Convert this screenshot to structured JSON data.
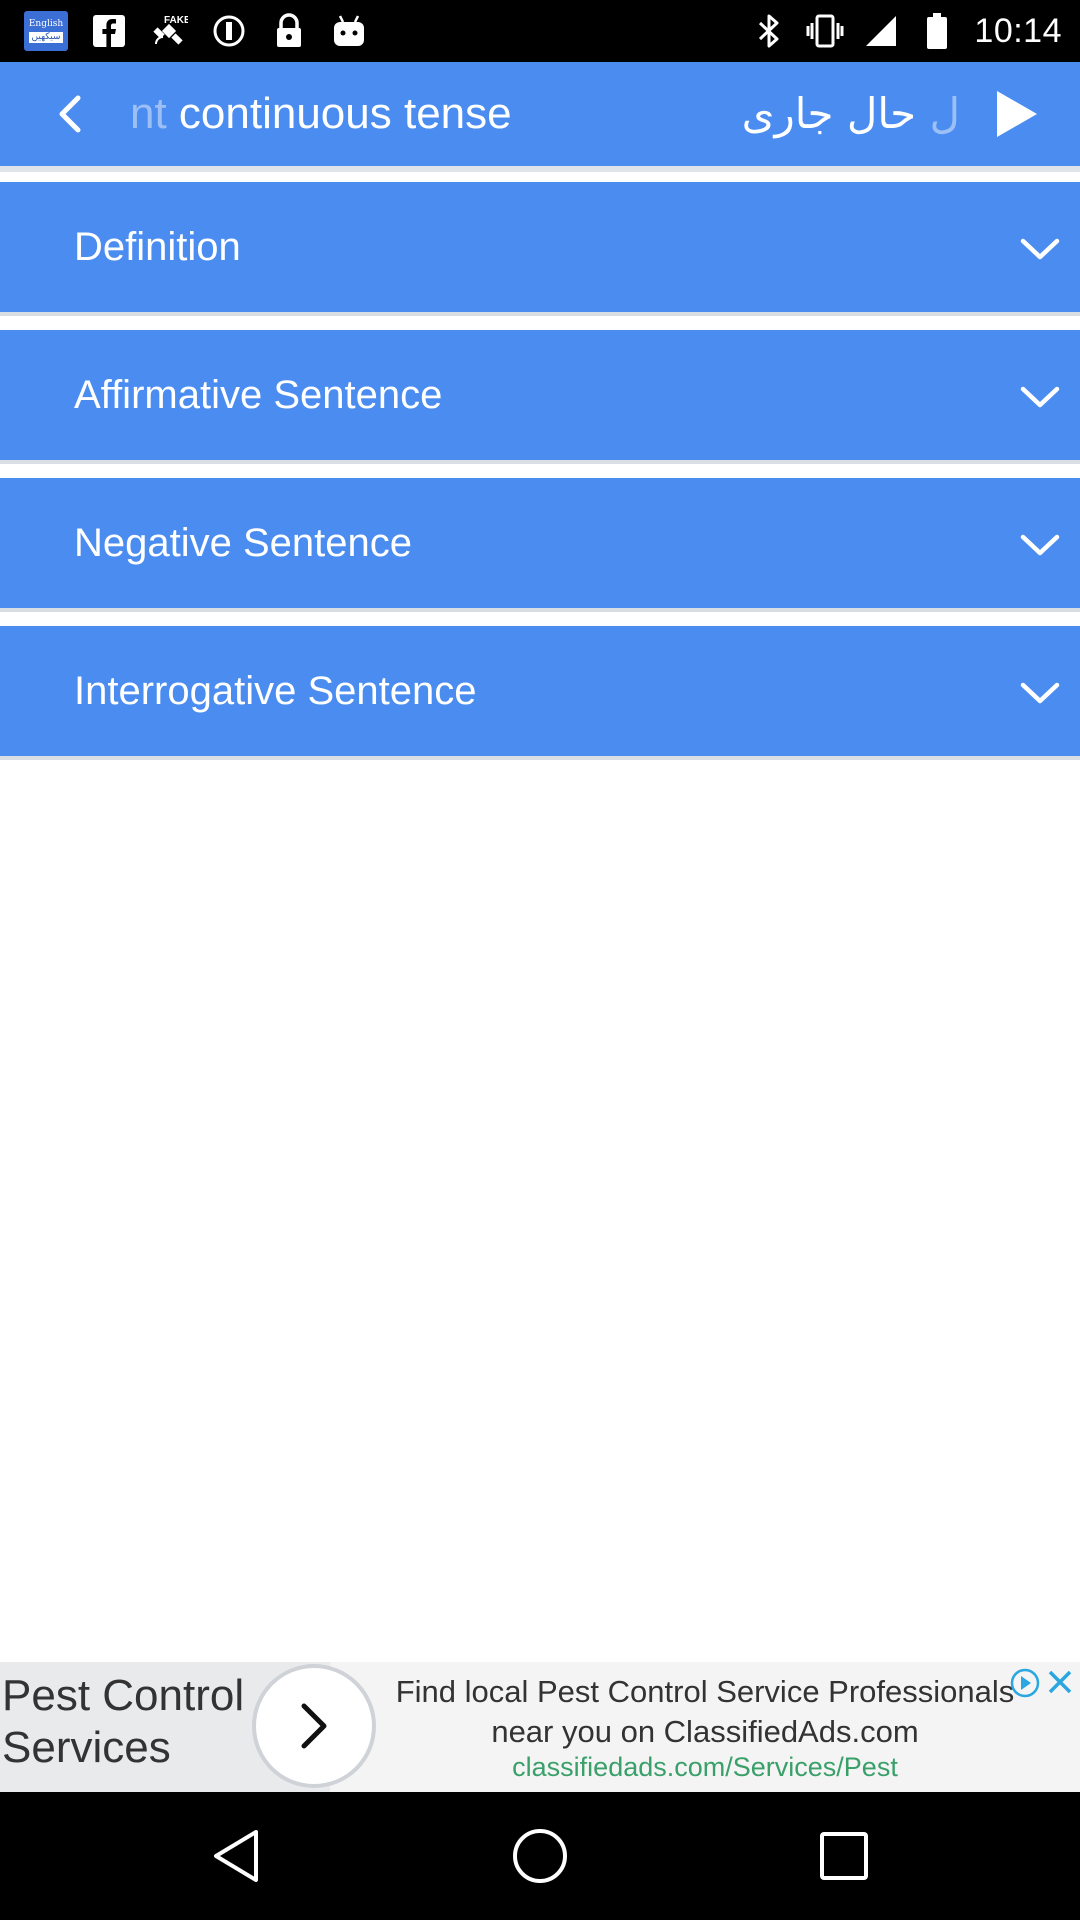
{
  "status_bar": {
    "app_badge_line1": "English",
    "app_badge_line2": "سیکھیں",
    "icons_left": [
      "app-notification-icon",
      "facebook-icon",
      "fake-gps-icon",
      "sync-icon",
      "lock-icon",
      "android-icon"
    ],
    "icons_right": [
      "bluetooth-icon",
      "vibrate-icon",
      "signal-icon",
      "battery-icon"
    ],
    "time": "10:14"
  },
  "header": {
    "title_en_faded": "nt",
    "title_en": " continuous tense",
    "title_ur_faded": "ل",
    "title_ur": " حال جاری",
    "back_icon": "chevron-left-icon",
    "play_icon": "play-icon"
  },
  "sections": [
    {
      "label": "Definition",
      "icon": "chevron-down-icon"
    },
    {
      "label": "Affirmative Sentence",
      "icon": "chevron-down-icon"
    },
    {
      "label": "Negative Sentence",
      "icon": "chevron-down-icon"
    },
    {
      "label": "Interrogative Sentence",
      "icon": "chevron-down-icon"
    }
  ],
  "ad": {
    "headline": "Pest Control Services",
    "description": "Find local Pest Control Service Professionals near you on ClassifiedAds.com",
    "url": "classifiedads.com/Services/Pest"
  },
  "colors": {
    "primary": "#4a8cf0",
    "status_bar": "#000000",
    "ad_url": "#3aa06a"
  }
}
